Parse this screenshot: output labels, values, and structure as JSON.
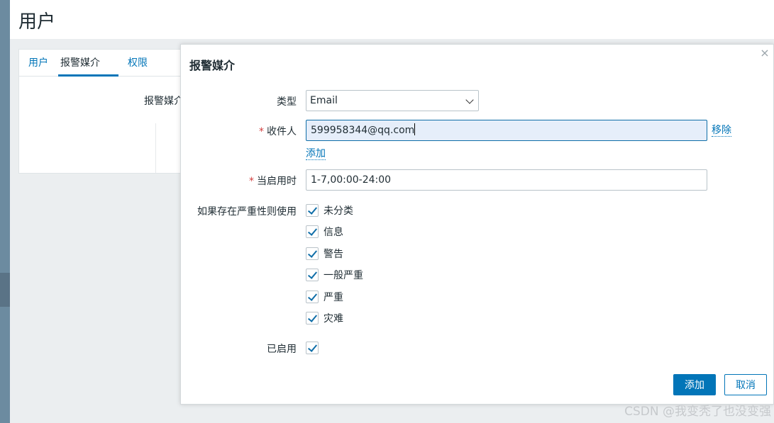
{
  "page": {
    "title": "用户"
  },
  "tabs": [
    {
      "label": "用户"
    },
    {
      "label": "报警媒介"
    },
    {
      "label": "权限"
    }
  ],
  "panel": {
    "media_label": "报警媒介"
  },
  "modal": {
    "title": "报警媒介",
    "close_glyph": "×",
    "type_label": "类型",
    "type_value": "Email",
    "recipient_label": "收件人",
    "recipient_value": "599958344@qq.com",
    "remove_link": "移除",
    "add_link": "添加",
    "when_active_label": "当启用时",
    "when_active_value": "1-7,00:00-24:00",
    "severity_label": "如果存在严重性则使用",
    "severities": [
      {
        "label": "未分类",
        "checked": true
      },
      {
        "label": "信息",
        "checked": true
      },
      {
        "label": "警告",
        "checked": true
      },
      {
        "label": "一般严重",
        "checked": true
      },
      {
        "label": "严重",
        "checked": true
      },
      {
        "label": "灾难",
        "checked": true
      }
    ],
    "enabled_label": "已启用",
    "enabled_checked": true,
    "add_button": "添加",
    "cancel_button": "取消"
  },
  "watermark": "CSDN @我变秃了也没变强",
  "colors": {
    "accent": "#0275b8",
    "required": "#d23f3f",
    "focus_bg": "#e6eefa"
  }
}
